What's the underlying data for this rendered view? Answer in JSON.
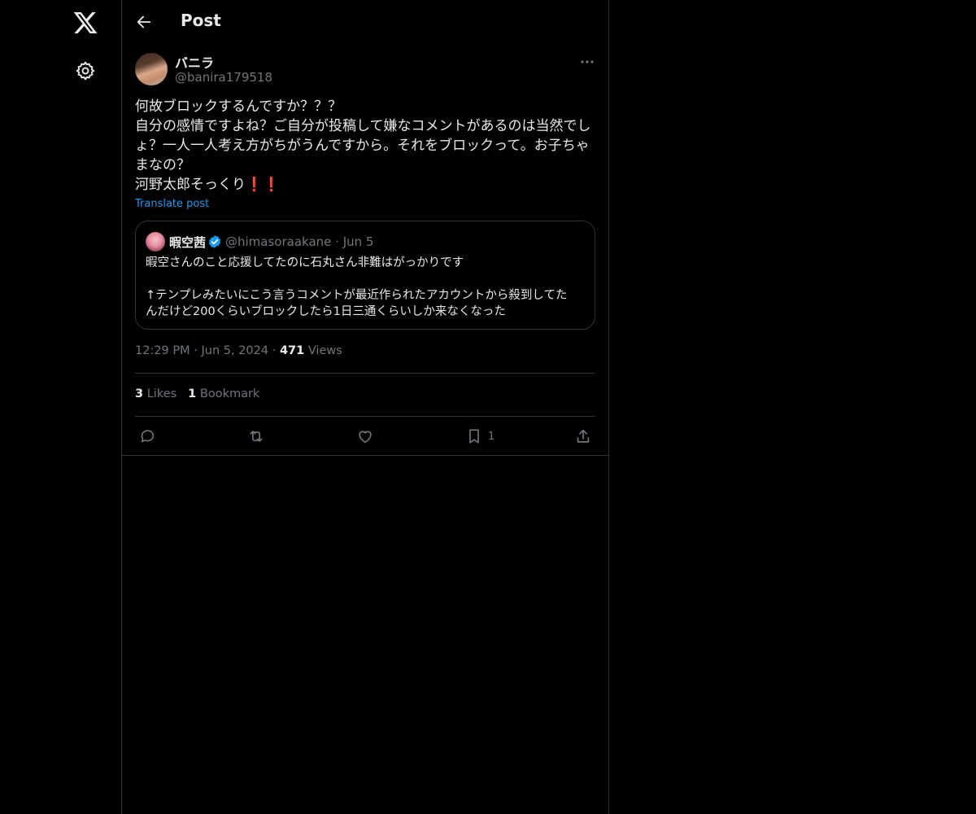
{
  "sidebar": {
    "logo_icon": "x-logo-icon",
    "settings_icon": "gear-icon"
  },
  "header": {
    "title": "Post",
    "back_icon": "arrow-left-icon"
  },
  "post": {
    "author_name": "バニラ",
    "author_handle": "@banira179518",
    "text_lines": [
      "何故ブロックするんですか？？？",
      "自分の感情ですよね？ご自分が投稿して嫌なコメントがあるのは当然でし",
      "ょ？一人一人考え方がちがうんですから。それをブロックって。お子ちゃ",
      "まなの？",
      "河野太郎そっくり"
    ],
    "emoji": "❗❗",
    "translate_label": "Translate post",
    "time": "12:29 PM",
    "date": "Jun 5, 2024",
    "views_count": "471",
    "views_label": "Views",
    "likes_count": "3",
    "likes_label": "Likes",
    "bookmarks_count": "1",
    "bookmarks_label": "Bookmark",
    "sep": "·"
  },
  "quote": {
    "name": "暇空茜",
    "handle": "@himasoraakane",
    "date": "Jun 5",
    "sep": "·",
    "text_lines": [
      "暇空さんのこと応援してたのに石丸さん非難はがっかりです",
      "",
      "↑テンプレみたいにこう言うコメントが最近作られたアカウントから殺到してた",
      "んだけど200くらいブロックしたら1日三通くらいしか来なくなった"
    ]
  },
  "actions": {
    "reply_icon": "reply-icon",
    "repost_icon": "repost-icon",
    "like_icon": "heart-icon",
    "bookmark_icon": "bookmark-icon",
    "bookmark_count": "1",
    "share_icon": "share-icon"
  },
  "colors": {
    "background": "#000000",
    "text": "#e7e9ea",
    "muted": "#71767b",
    "accent": "#1d9bf0",
    "border": "#2f3336"
  }
}
